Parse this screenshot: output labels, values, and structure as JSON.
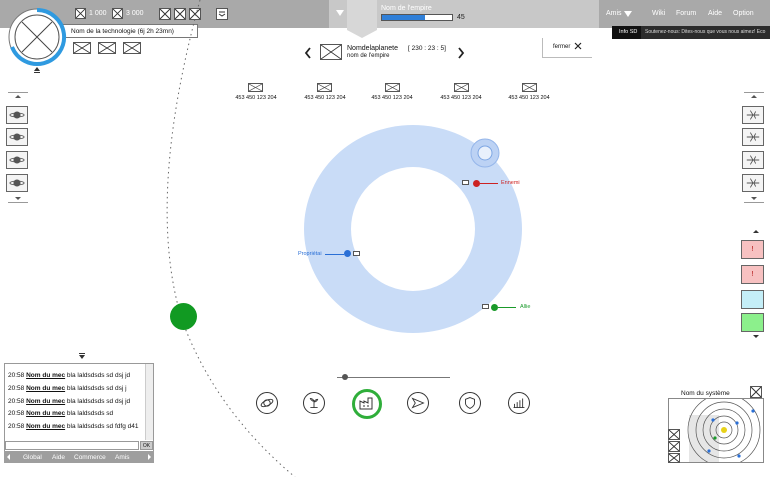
{
  "tech": {
    "name": "Nom de la technologie (6j 2h 23mn)"
  },
  "resources_top": [
    {
      "value": "1 000"
    },
    {
      "value": "3 000"
    }
  ],
  "empire_bar": {
    "label": "Nom de l'empire",
    "value": "45",
    "progress": 0.62
  },
  "top_nav": {
    "friends": "Amis",
    "wiki": "Wiki",
    "forum": "Forum",
    "help": "Aide",
    "options": "Option"
  },
  "info_bar": {
    "tag": "Info SD",
    "message": "Soutenez-nous: Dites-nous que vous nous aimez! Eco"
  },
  "planet": {
    "name": "Nomdelaplanete",
    "empire": "nom de l'empire",
    "coords": "[ 230 : 23 : 5]"
  },
  "close_label": "fermer",
  "resource_cells": [
    {
      "value": "453 450 123 204"
    },
    {
      "value": "453 450 123 204"
    },
    {
      "value": "453 450 123 204"
    },
    {
      "value": "453 450 123 204"
    },
    {
      "value": "453 450 123 204"
    }
  ],
  "orbit_labels": {
    "enemy": "Ennemi",
    "owner": "Propriétai",
    "ally": "Allie"
  },
  "colors": {
    "enemy": "#cc2222",
    "owner": "#2a6fd6",
    "ally": "#1a9a2a",
    "orbit": "#c9dcf7",
    "planet": "#119a22"
  },
  "slider": {
    "value": 0.05
  },
  "chat": {
    "lines": [
      {
        "time": "20:58",
        "user": "Nom du mec",
        "text": "bla laldsdsds sd dsj jd"
      },
      {
        "time": "20:58",
        "user": "Nom du mec",
        "text": "bla laldsdsds sd dsj j"
      },
      {
        "time": "20:58",
        "user": "Nom du mec",
        "text": "bla laldsdsds sd dsj jd"
      },
      {
        "time": "20:58",
        "user": "Nom du mec",
        "text": "bla laldsdsds sd"
      },
      {
        "time": "20:58",
        "user": "Nom du mec",
        "text": "bla laldsdsds sd fdfg d41"
      }
    ],
    "send_label": "OK",
    "tabs": [
      "Global",
      "Aide",
      "Commerce",
      "Amis"
    ]
  },
  "system": {
    "name": "Nom du système"
  },
  "alerts": [
    {
      "label": "!"
    },
    {
      "label": "!"
    }
  ],
  "icons": {
    "bottom": [
      "planet-icon",
      "plant-icon",
      "factory-icon",
      "send-icon",
      "shield-icon",
      "stats-icon"
    ]
  }
}
